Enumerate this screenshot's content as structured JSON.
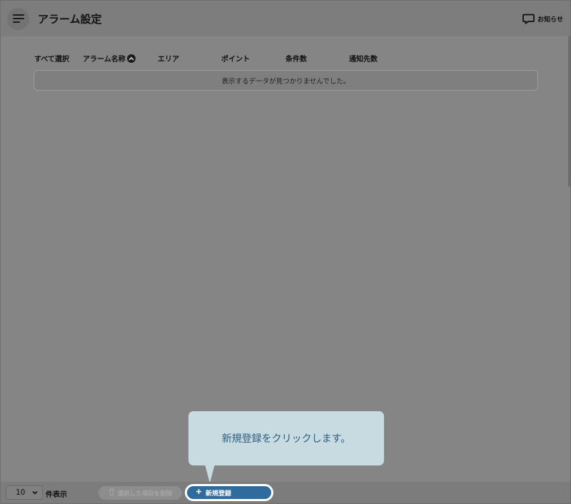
{
  "header": {
    "title": "アラーム設定",
    "menu_icon": "hamburger-menu-icon",
    "notice_icon": "chat-bubble-icon",
    "notice_label": "お知らせ"
  },
  "table": {
    "columns": [
      "すべて選択",
      "アラーム名称",
      "エリア",
      "ポイント",
      "条件数",
      "通知先数"
    ],
    "sort_icon": "chevron-up-icon",
    "empty_message": "表示するデータが見つかりませんでした。"
  },
  "tooltip": {
    "text": "新規登録をクリックします。"
  },
  "footer": {
    "per_page_value": "10",
    "per_page_label": "件表示",
    "delete_label": "選択した項目を削除",
    "delete_icon": "trash-icon",
    "new_label": "新規登録",
    "new_icon": "plus-icon"
  },
  "colors": {
    "primary": "#2f6b9c",
    "tooltip_bg": "#c7dbe0",
    "tooltip_text": "#2d5c7c"
  }
}
